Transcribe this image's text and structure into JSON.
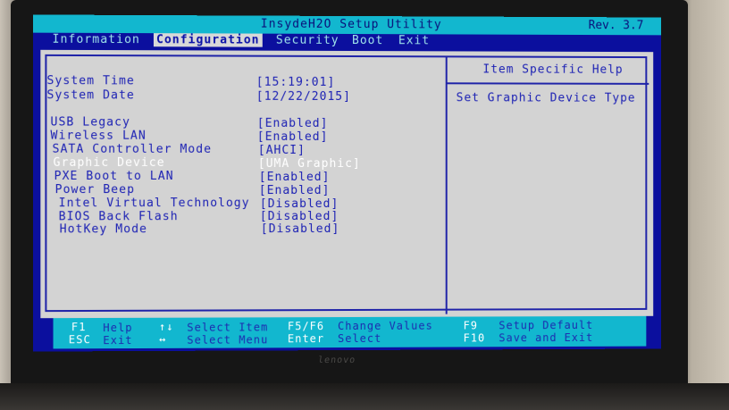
{
  "title": "InsydeH2O Setup Utility",
  "revision": "Rev. 3.7",
  "menu": [
    {
      "label": "Information"
    },
    {
      "label": "Configuration"
    },
    {
      "label": "Security"
    },
    {
      "label": "Boot"
    },
    {
      "label": "Exit"
    }
  ],
  "items": [
    {
      "label": "System Time",
      "value": "[15:19:01]"
    },
    {
      "label": "System Date",
      "value": "[12/22/2015]"
    },
    {
      "label": "USB Legacy",
      "value": "[Enabled]"
    },
    {
      "label": "Wireless LAN",
      "value": "[Enabled]"
    },
    {
      "label": "SATA Controller Mode",
      "value": "[AHCI]"
    },
    {
      "label": "Graphic Device",
      "value": "[UMA Graphic]"
    },
    {
      "label": "PXE Boot to LAN",
      "value": "[Enabled]"
    },
    {
      "label": "Power Beep",
      "value": "[Enabled]"
    },
    {
      "label": "Intel Virtual Technology",
      "value": "[Disabled]"
    },
    {
      "label": "BIOS Back Flash",
      "value": "[Disabled]"
    },
    {
      "label": "HotKey Mode",
      "value": "[Disabled]"
    }
  ],
  "help": {
    "title": "Item Specific Help",
    "text": "Set Graphic Device Type"
  },
  "footer": [
    {
      "key": "F1",
      "desc": "Help"
    },
    {
      "key": "ESC",
      "desc": "Exit"
    },
    {
      "key": "↑↓",
      "desc": "Select Item"
    },
    {
      "key": "↔",
      "desc": "Select Menu"
    },
    {
      "key": "F5/F6",
      "desc": "Change Values"
    },
    {
      "key": "Enter",
      "desc": "Select"
    },
    {
      "key": "F9",
      "desc": "Setup Default"
    },
    {
      "key": "F10",
      "desc": "Save and Exit"
    }
  ],
  "bezel_brand": "lenovo",
  "colors": {
    "screen_bg": "#0b0f9e",
    "title_bar": "#12b7cf",
    "panel_bg": "#d3d3d3",
    "item_text": "#1d22b4",
    "selected_text": "#ffffff"
  }
}
